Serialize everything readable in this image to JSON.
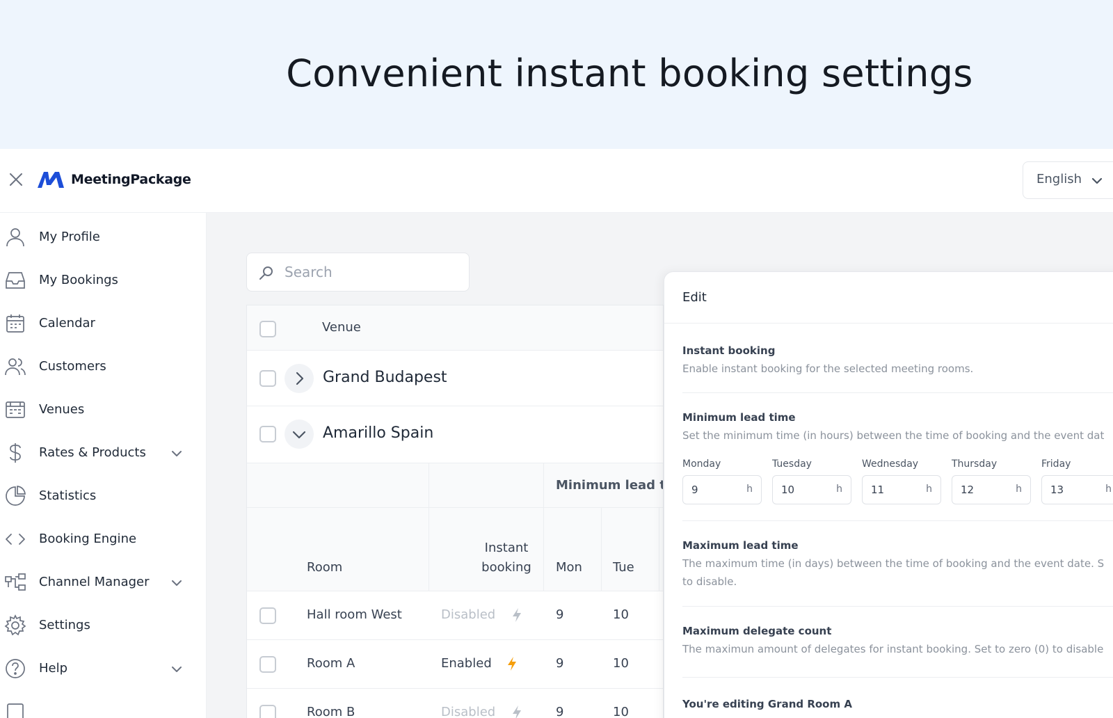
{
  "hero": {
    "title": "Convenient instant booking settings"
  },
  "topbar": {
    "brand": "MeetingPackage",
    "language": "English"
  },
  "sidebar": {
    "items": [
      {
        "label": "My Profile",
        "icon": "user-icon",
        "has_chevron": false
      },
      {
        "label": "My Bookings",
        "icon": "inbox-icon",
        "has_chevron": false
      },
      {
        "label": "Calendar",
        "icon": "calendar-icon",
        "has_chevron": false
      },
      {
        "label": "Customers",
        "icon": "users-icon",
        "has_chevron": false
      },
      {
        "label": "Venues",
        "icon": "building-icon",
        "has_chevron": false
      },
      {
        "label": "Rates & Products",
        "icon": "dollar-icon",
        "has_chevron": true
      },
      {
        "label": "Statistics",
        "icon": "pie-chart-icon",
        "has_chevron": false
      },
      {
        "label": "Booking Engine",
        "icon": "code-icon",
        "has_chevron": false
      },
      {
        "label": "Channel Manager",
        "icon": "network-icon",
        "has_chevron": true
      },
      {
        "label": "Settings",
        "icon": "gear-icon",
        "has_chevron": false
      },
      {
        "label": "Help",
        "icon": "help-circle-icon",
        "has_chevron": true
      }
    ]
  },
  "search": {
    "placeholder": "Search"
  },
  "table": {
    "venue_header": "Venue",
    "venues": [
      {
        "name": "Grand Budapest",
        "expanded": false
      },
      {
        "name": "Amarillo Spain",
        "expanded": true
      }
    ],
    "group_header": "Minimum lead ti",
    "columns": {
      "room": "Room",
      "instant_line1": "Instant",
      "instant_line2": "booking",
      "mon": "Mon",
      "tue": "Tue"
    },
    "rows": [
      {
        "room": "Hall room West",
        "status": "Disabled",
        "enabled": false,
        "mon": "9",
        "tue": "10"
      },
      {
        "room": "Room A",
        "status": "Enabled",
        "enabled": true,
        "mon": "9",
        "tue": "10"
      },
      {
        "room": "Room B",
        "status": "Disabled",
        "enabled": false,
        "mon": "9",
        "tue": "10"
      }
    ]
  },
  "panel": {
    "title": "Edit",
    "instant": {
      "title": "Instant booking",
      "desc": "Enable instant booking for the selected meeting rooms."
    },
    "min_lead": {
      "title": "Minimum lead time",
      "desc": "Set the minimum time (in hours) between the time of booking and the event dat",
      "unit": "h",
      "days": [
        {
          "label": "Monday",
          "value": "9"
        },
        {
          "label": "Tuesday",
          "value": "10"
        },
        {
          "label": "Wednesday",
          "value": "11"
        },
        {
          "label": "Thursday",
          "value": "12"
        },
        {
          "label": "Friday",
          "value": "13"
        }
      ]
    },
    "max_lead": {
      "title": "Maximum lead time",
      "desc1": "The maximum time (in days) between the time of booking and the event date. S",
      "desc2": "to disable."
    },
    "max_delegates": {
      "title": "Maximum delegate count",
      "desc": "The maximun amount of delegates for instant booking. Set to zero (0) to disable"
    },
    "editing": "You're editing Grand Room A"
  },
  "colors": {
    "brand_blue": "#1d4ed8",
    "accent_orange": "#f59e0b",
    "hero_bg": "#eef5fd",
    "content_bg": "#f3f4f6"
  }
}
